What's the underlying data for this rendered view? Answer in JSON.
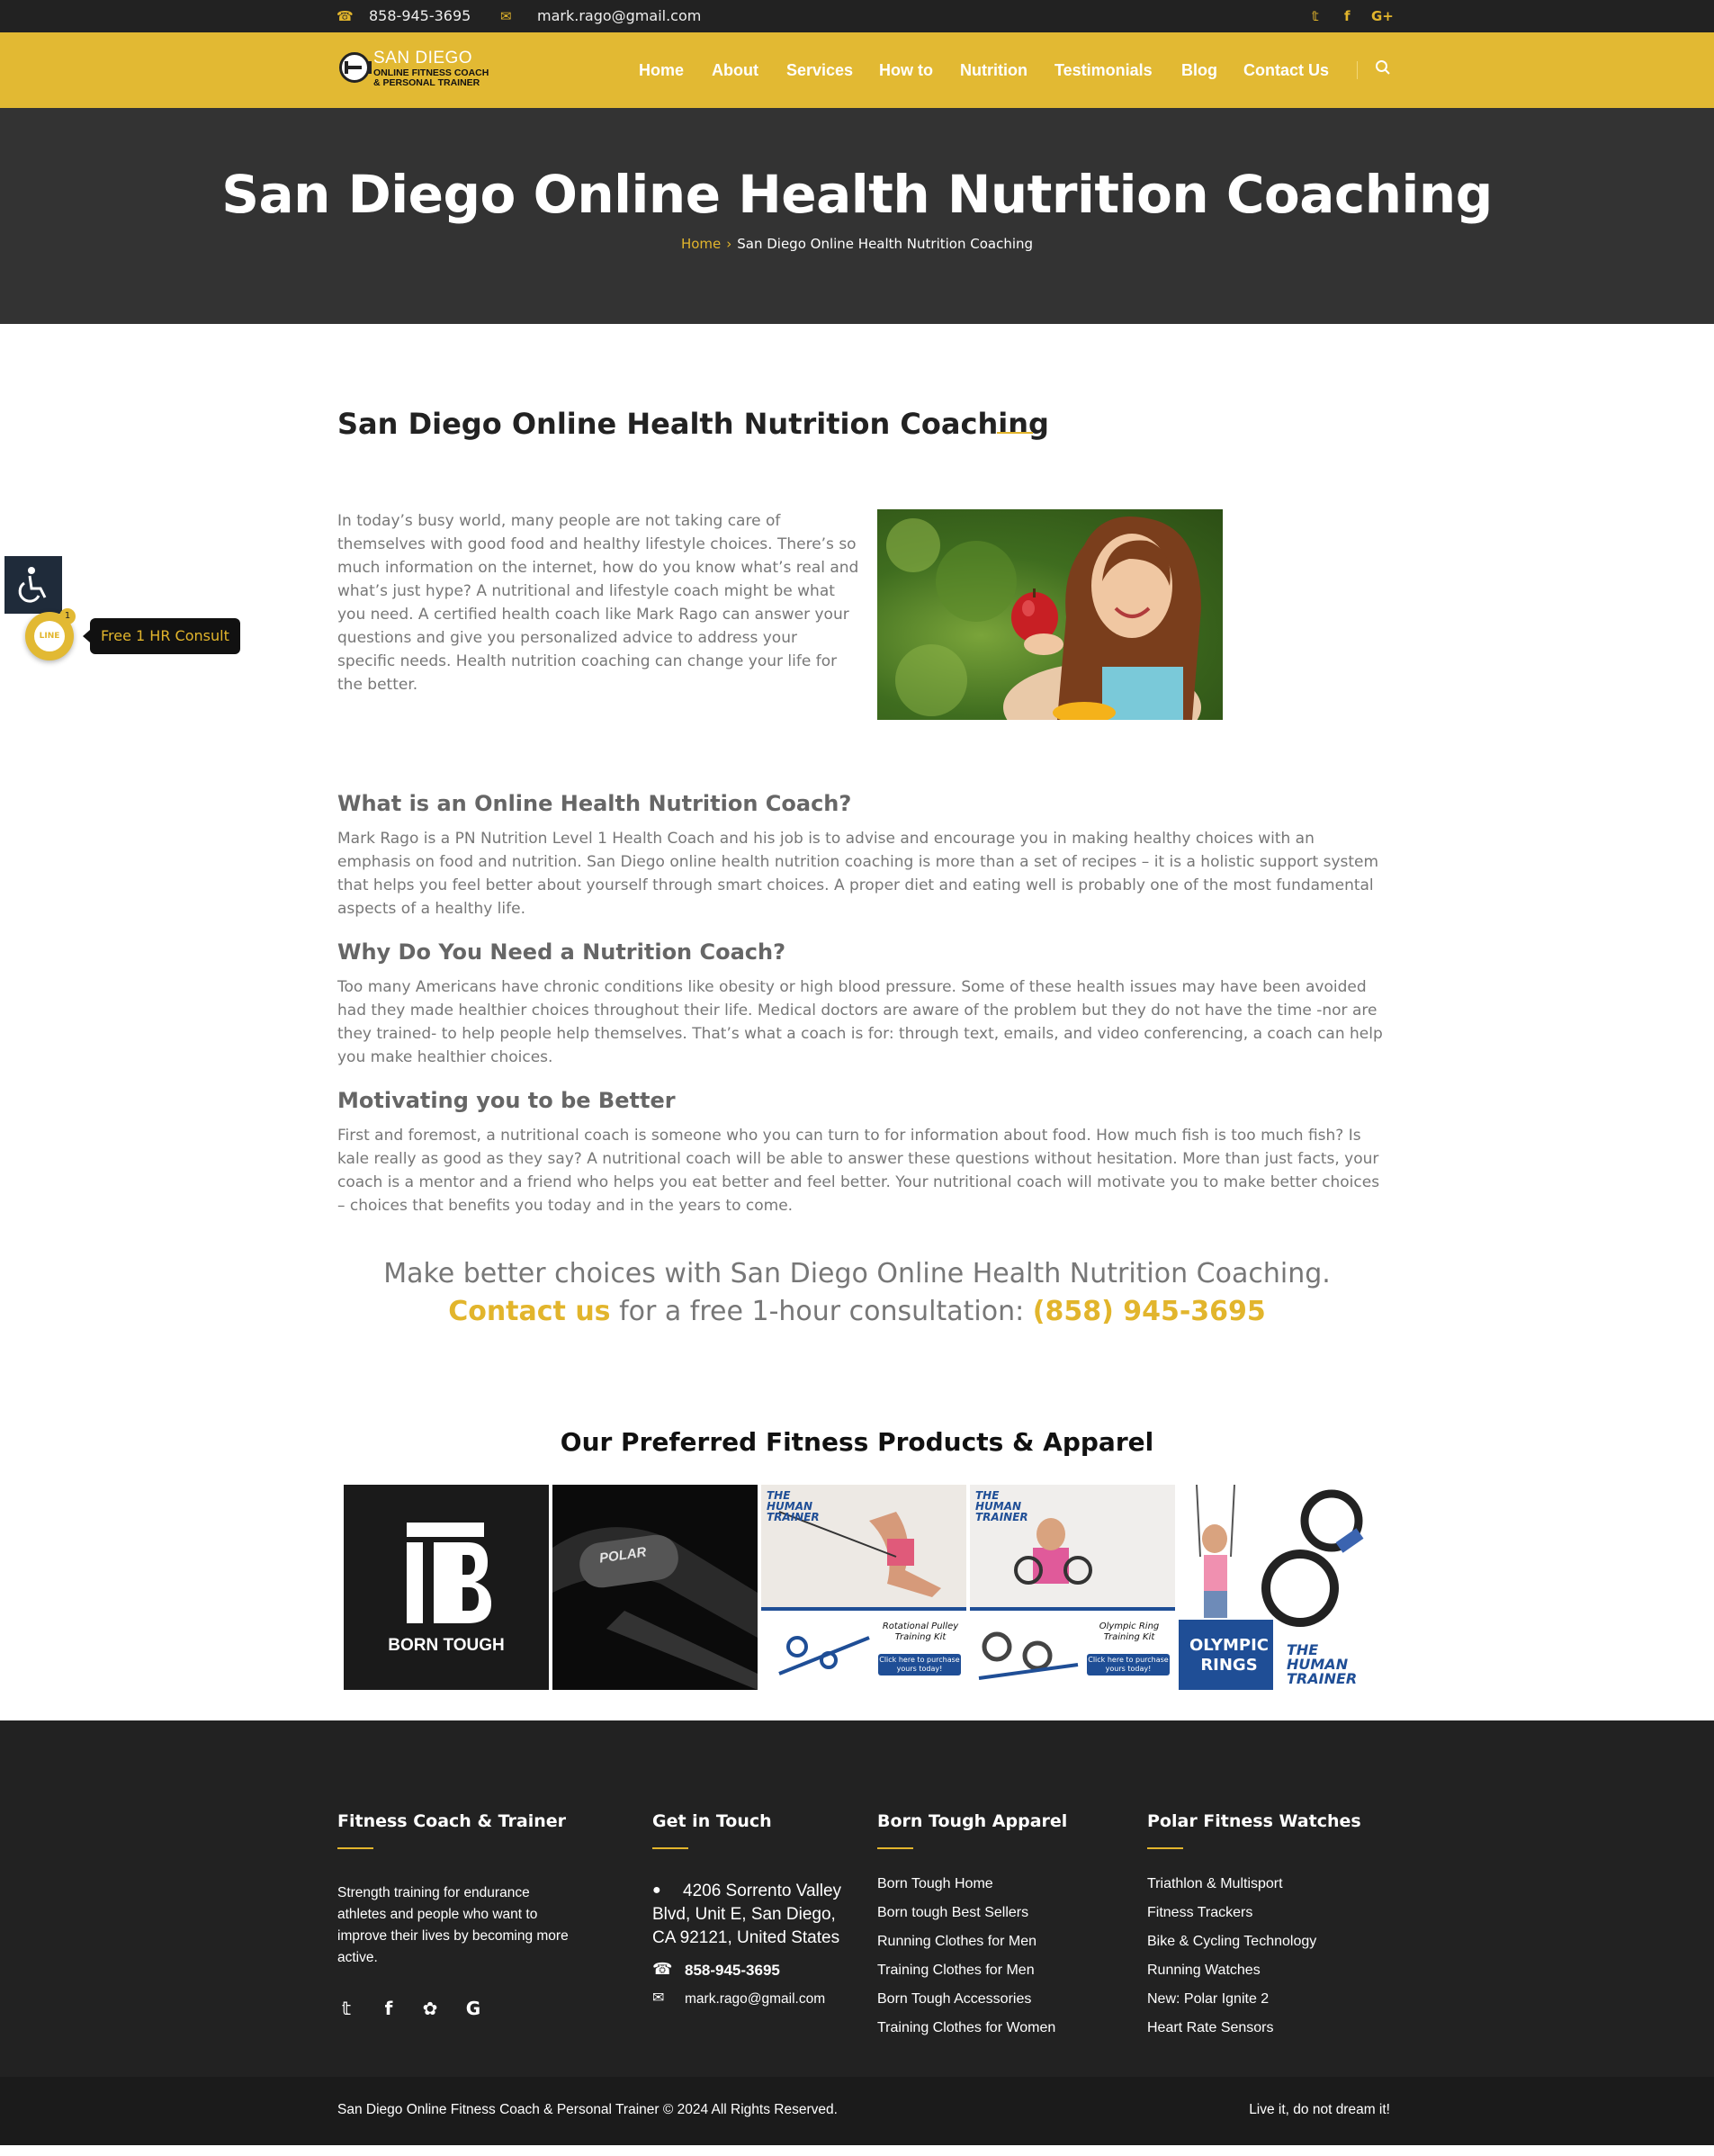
{
  "topbar": {
    "phone": "858-945-3695",
    "email": "mark.rago@gmail.com",
    "social_icons": [
      "twitter-icon",
      "facebook-icon",
      "google-plus-icon"
    ]
  },
  "logo": {
    "line1": "SAN DIEGO",
    "line2": "ONLINE FITNESS COACH",
    "line3": "& PERSONAL TRAINER"
  },
  "nav": {
    "items": [
      "Home",
      "About",
      "Services",
      "How to",
      "Nutrition",
      "Testimonials",
      "Blog",
      "Contact Us"
    ]
  },
  "hero": {
    "title": "San Diego Online Health Nutrition Coaching",
    "breadcrumb_home": "Home",
    "breadcrumb_sep": "›",
    "breadcrumb_current": "San Diego Online Health Nutrition Coaching"
  },
  "main": {
    "heading": "San Diego Online Health Nutrition Coaching",
    "intro": "In today’s busy world, many people are not taking care of themselves with good food and healthy lifestyle choices. There’s so much information on the internet, how do you know what’s real and what’s just hype?  A nutritional and lifestyle coach might be what you need. A certified health coach like Mark Rago can answer your questions and give you personalized advice to address your specific needs.  Health nutrition coaching can change your life for the better.",
    "sections": [
      {
        "heading": "What is an Online Health Nutrition Coach?",
        "body": "Mark Rago is a PN Nutrition Level 1 Health Coach and his job is to advise and encourage you in making healthy choices with an emphasis on food and nutrition. San Diego online health nutrition coaching is more than a set of recipes – it is a holistic support system that helps you feel better about yourself through smart choices. A proper diet and eating well is probably one of the most fundamental aspects of a healthy life."
      },
      {
        "heading": "Why Do You Need a Nutrition Coach?",
        "body": "Too many Americans have chronic conditions like obesity or high blood pressure. Some of these health issues may have been avoided had they made healthier choices throughout their life. Medical doctors are aware of the problem but they do not have the time -nor are they trained- to help people help themselves. That’s what a coach is for: through text,  emails, and video conferencing, a coach can help you make healthier choices."
      },
      {
        "heading": "Motivating you to be Better",
        "body": "First and foremost, a nutritional coach is someone who you can turn to for information about food. How much fish is too much fish? Is kale really as good as they say? A nutritional coach will be able to answer these questions without hesitation. More than just facts, your coach is a mentor and a friend who helps you eat better and feel better.  Your nutritional coach will motivate you to make better choices – choices that benefits you today and in the years to come."
      }
    ],
    "cta_line1": "Make better choices with San Diego Online Health Nutrition Coaching.",
    "cta_contact": "Contact us",
    "cta_mid": " for a free 1-hour consultation:  ",
    "cta_phone": "(858) 945-3695"
  },
  "products": {
    "heading": "Our Preferred Fitness Products & Apparel",
    "tiles": [
      {
        "brand": "BORN TOUGH"
      },
      {
        "brand": "POLAR"
      },
      {
        "brand": "THE HUMAN TRAINER",
        "caption": "Rotational Pulley Training Kit",
        "button": "Click here to purchase yours today!"
      },
      {
        "brand": "THE HUMAN TRAINER",
        "caption": "Olympic Ring Training Kit",
        "button": "Click here to purchase yours today!"
      },
      {
        "brand": "THE HUMAN TRAINER",
        "caption": "OLYMPIC RINGS"
      }
    ]
  },
  "footer": {
    "col1": {
      "heading": "Fitness Coach & Trainer",
      "text": "Strength training for endurance athletes and people who want to improve their lives by becoming more active.",
      "social_icons": [
        "twitter-icon",
        "facebook-icon",
        "yelp-icon",
        "google-icon"
      ]
    },
    "col2": {
      "heading": "Get in Touch",
      "address": "4206 Sorrento Valley Blvd, Unit E, San Diego, CA 92121, United States",
      "phone": "858-945-3695",
      "email": "mark.rago@gmail.com"
    },
    "col3": {
      "heading": "Born Tough Apparel",
      "links": [
        "Born Tough Home",
        "Born tough Best Sellers",
        "Running Clothes for Men",
        "Training Clothes for Men",
        "Born Tough Accessories",
        "Training Clothes for Women"
      ]
    },
    "col4": {
      "heading": "Polar Fitness Watches",
      "links": [
        "Triathlon & Multisport",
        "Fitness Trackers",
        "Bike & Cycling Technology",
        "Running Watches",
        "New: Polar Ignite 2",
        "Heart Rate Sensors"
      ]
    },
    "copyright": "San Diego Online Fitness Coach & Personal Trainer © 2024 All Rights Reserved.",
    "motto": "Live it, do not dream it!"
  },
  "widgets": {
    "chat_label": "LINE",
    "chat_badge": "1",
    "chat_tooltip": "Free 1 HR Consult"
  },
  "colors": {
    "accent": "#e2b933",
    "dark": "#222222",
    "hero": "#333333"
  }
}
